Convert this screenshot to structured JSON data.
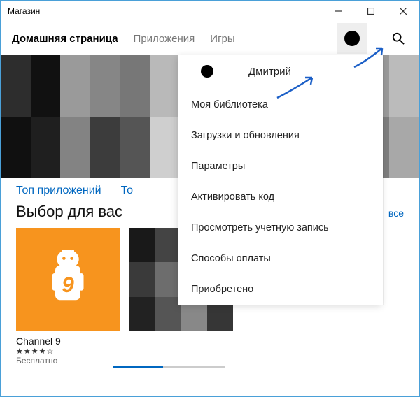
{
  "window": {
    "title": "Магазин"
  },
  "nav": {
    "tabs": [
      "Домашняя страница",
      "Приложения",
      "Игры"
    ],
    "active_index": 0
  },
  "dropdown": {
    "username": "Дмитрий",
    "items": [
      "Моя библиотека",
      "Загрузки и обновления",
      "Параметры",
      "Активировать код",
      "Просмотреть учетную запись",
      "Способы оплаты",
      "Приобретено"
    ]
  },
  "sections": {
    "tabs": [
      "Топ приложений",
      "То"
    ],
    "picks_title": "Выбор для вас",
    "see_all": "все"
  },
  "card": {
    "title": "Channel 9",
    "rating": "★★★★☆",
    "price": "Бесплатно"
  },
  "colors": {
    "accent": "#0067c0",
    "card_bg": "#f7941e"
  }
}
